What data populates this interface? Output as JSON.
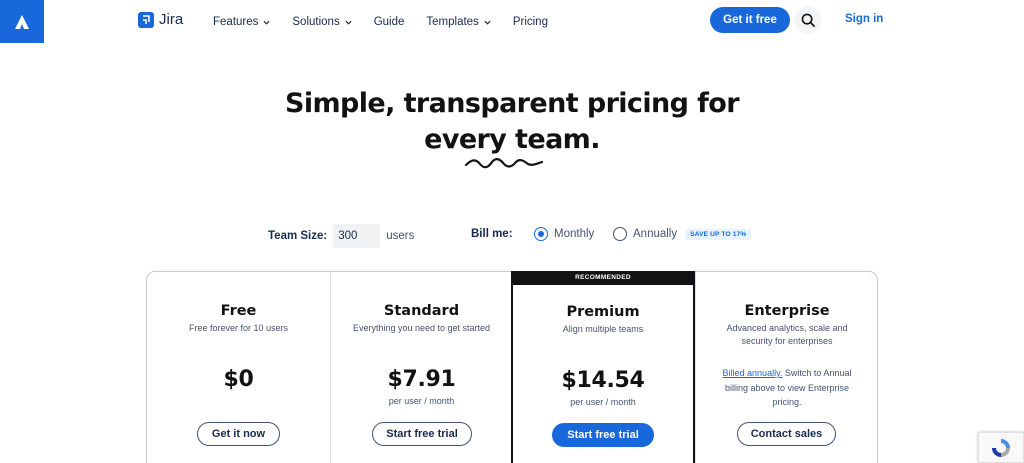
{
  "header": {
    "brand": "Jira",
    "nav": [
      {
        "label": "Features",
        "dropdown": true
      },
      {
        "label": "Solutions",
        "dropdown": true
      },
      {
        "label": "Guide",
        "dropdown": false
      },
      {
        "label": "Templates",
        "dropdown": true
      },
      {
        "label": "Pricing",
        "dropdown": false
      }
    ],
    "cta_label": "Get it free",
    "search_icon": "search-icon",
    "signin_label": "Sign in"
  },
  "hero": {
    "title_line1": "Simple, transparent pricing for",
    "title_line2": "every team."
  },
  "controls": {
    "team_size_label": "Team Size:",
    "team_size_value": "300",
    "team_size_units": "users",
    "bill_label": "Bill me:",
    "monthly_label": "Monthly",
    "annually_label": "Annually",
    "save_badge": "SAVE UP TO 17%",
    "selected_billing": "Monthly"
  },
  "plans": [
    {
      "name": "Free",
      "desc": "Free forever for 10 users",
      "price": "$0",
      "unit": "",
      "button": "Get it now"
    },
    {
      "name": "Standard",
      "desc": "Everything you need to get started",
      "price": "$7.91",
      "unit": "per user / month",
      "button": "Start free trial"
    },
    {
      "name": "Premium",
      "desc": "Align multiple teams",
      "price": "$14.54",
      "unit": "per user / month",
      "button": "Start free trial",
      "badge": "RECOMMENDED"
    },
    {
      "name": "Enterprise",
      "desc": "Advanced analytics, scale and security for enterprises",
      "note_link": "Billed annually.",
      "note_text": " Switch to Annual billing above to view Enterprise pricing.",
      "button": "Contact sales"
    }
  ],
  "colors": {
    "accent": "#1868db",
    "text_dark": "#101214",
    "text_subtle": "#44546f"
  }
}
